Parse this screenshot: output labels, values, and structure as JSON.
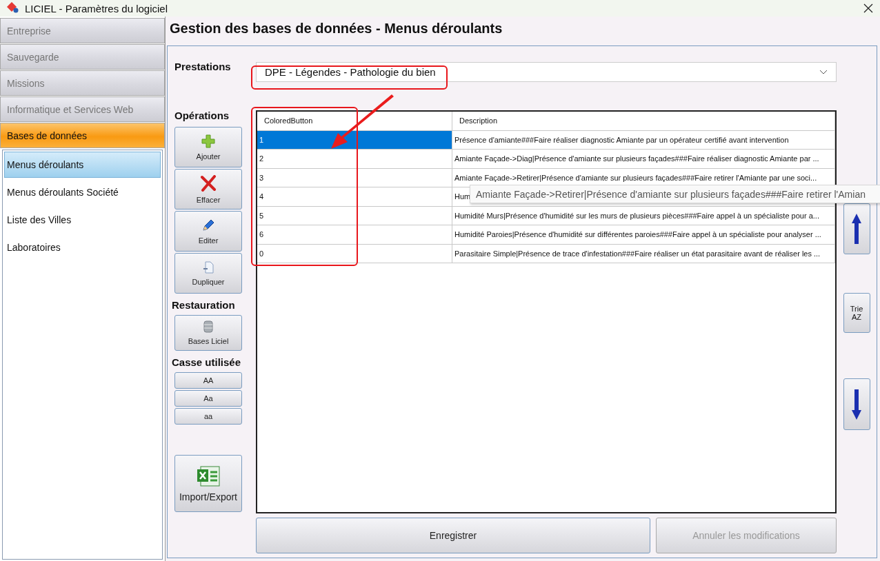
{
  "window": {
    "title": "LICIEL - Paramètres du logiciel"
  },
  "sidebar": {
    "sections": [
      {
        "label": "Entreprise",
        "selected": false
      },
      {
        "label": "Sauvegarde",
        "selected": false
      },
      {
        "label": "Missions",
        "selected": false
      },
      {
        "label": "Informatique et Services Web",
        "selected": false
      },
      {
        "label": "Bases de données",
        "selected": true
      }
    ],
    "items": [
      {
        "label": "Menus déroulants",
        "selected": true
      },
      {
        "label": "Menus déroulants Société",
        "selected": false
      },
      {
        "label": "Liste des Villes",
        "selected": false
      },
      {
        "label": "Laboratoires",
        "selected": false
      }
    ]
  },
  "heading": "Gestion des bases de données - Menus déroulants",
  "prestations": {
    "label": "Prestations",
    "value": "DPE - Légendes - Pathologie du bien"
  },
  "operations": {
    "label": "Opérations",
    "buttons": [
      {
        "kind": "add",
        "label": "Ajouter"
      },
      {
        "kind": "delete",
        "label": "Effacer"
      },
      {
        "kind": "edit",
        "label": "Editer"
      },
      {
        "kind": "duplicate",
        "label": "Dupliquer"
      }
    ]
  },
  "restauration": {
    "label": "Restauration",
    "button": "Bases Liciel"
  },
  "casse": {
    "label": "Casse utilisée",
    "buttons": [
      "AA",
      "Aa",
      "aa"
    ]
  },
  "import_export": "Import/Export",
  "table": {
    "columns": [
      "ColoredButton",
      "Description"
    ],
    "rows": [
      {
        "selected": true,
        "cells": [
          "1",
          "Présence d'amiante###Faire réaliser diagnostic Amiante par un opérateur certifié avant intervention"
        ]
      },
      {
        "selected": false,
        "cells": [
          "2",
          "Amiante Façade->Diag|Présence d'amiante sur plusieurs façades###Faire réaliser diagnostic Amiante par ..."
        ]
      },
      {
        "selected": false,
        "cells": [
          "3",
          "Amiante Façade->Retirer|Présence d'amiante sur plusieurs façades###Faire retirer l'Amiante par une soci..."
        ]
      },
      {
        "selected": false,
        "cells": [
          "4",
          "Hum"
        ]
      },
      {
        "selected": false,
        "cells": [
          "5",
          "Humidité Murs|Présence d'humidité sur les murs de plusieurs pièces###Faire appel à un spécialiste pour a..."
        ]
      },
      {
        "selected": false,
        "cells": [
          "6",
          "Humidité Paroies|Présence d'humidité sur différentes paroies###Faire appel à un spécialiste pour analyser ..."
        ]
      },
      {
        "selected": false,
        "cells": [
          "0",
          "Parasitaire Simple|Présence de trace d'infestation###Faire réaliser un état parasitaire avant de réaliser les ..."
        ]
      }
    ]
  },
  "tooltip": "Amiante Façade->Retirer|Présence d'amiante sur plusieurs façades###Faire retirer l'Amian",
  "sort_button": {
    "line1": "Trie",
    "line2": "AZ"
  },
  "footer": [
    {
      "label": "Enregistrer",
      "disabled": false
    },
    {
      "label": "Annuler les modifications",
      "disabled": true
    }
  ]
}
